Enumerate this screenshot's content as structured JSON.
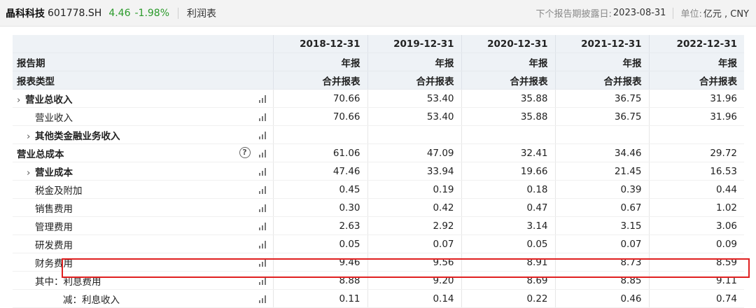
{
  "header": {
    "stock_name": "晶科科技",
    "stock_code": "601778.SH",
    "price": "4.46",
    "change": "-1.98%",
    "report_type": "利润表",
    "next_report_label": "下个报告期披露日:",
    "next_report_date": "2023-08-31",
    "unit_label": "单位:",
    "unit_value": "亿元 , CNY"
  },
  "table": {
    "columns": [
      "2018-12-31",
      "2019-12-31",
      "2020-12-31",
      "2021-12-31",
      "2022-12-31"
    ],
    "period_label": "报告期",
    "period_values": [
      "年报",
      "年报",
      "年报",
      "年报",
      "年报"
    ],
    "type_label": "报表类型",
    "type_values": [
      "合并报表",
      "合并报表",
      "合并报表",
      "合并报表",
      "合并报表"
    ],
    "rows": [
      {
        "label": "营业总收入",
        "values": [
          "70.66",
          "53.40",
          "35.88",
          "36.75",
          "31.96"
        ]
      },
      {
        "label": "营业收入",
        "values": [
          "70.66",
          "53.40",
          "35.88",
          "36.75",
          "31.96"
        ]
      },
      {
        "label": "其他类金融业务收入",
        "values": [
          "",
          "",
          "",
          "",
          ""
        ]
      },
      {
        "label": "营业总成本",
        "values": [
          "61.06",
          "47.09",
          "32.41",
          "34.46",
          "29.72"
        ]
      },
      {
        "label": "营业成本",
        "values": [
          "47.46",
          "33.94",
          "19.66",
          "21.45",
          "16.53"
        ]
      },
      {
        "label": "税金及附加",
        "values": [
          "0.45",
          "0.19",
          "0.18",
          "0.39",
          "0.44"
        ]
      },
      {
        "label": "销售费用",
        "values": [
          "0.30",
          "0.42",
          "0.47",
          "0.67",
          "1.02"
        ]
      },
      {
        "label": "管理费用",
        "values": [
          "2.63",
          "2.92",
          "3.14",
          "3.15",
          "3.06"
        ]
      },
      {
        "label": "研发费用",
        "values": [
          "0.05",
          "0.07",
          "0.05",
          "0.07",
          "0.09"
        ]
      },
      {
        "label": "财务费用",
        "values": [
          "9.46",
          "9.56",
          "8.91",
          "8.73",
          "8.59"
        ]
      },
      {
        "label": "其中：利息费用",
        "values": [
          "8.88",
          "9.20",
          "8.69",
          "8.85",
          "9.11"
        ]
      },
      {
        "label": "减：利息收入",
        "values": [
          "0.11",
          "0.14",
          "0.22",
          "0.46",
          "0.74"
        ]
      }
    ]
  },
  "colors": {
    "positive_change": "#2a9a2a",
    "highlight": "#e02020",
    "header_bg": "#eef2f6"
  },
  "icons": {
    "chart": "bar-chart-icon",
    "expand": "chevron-right-icon",
    "help": "question-circle-icon"
  }
}
